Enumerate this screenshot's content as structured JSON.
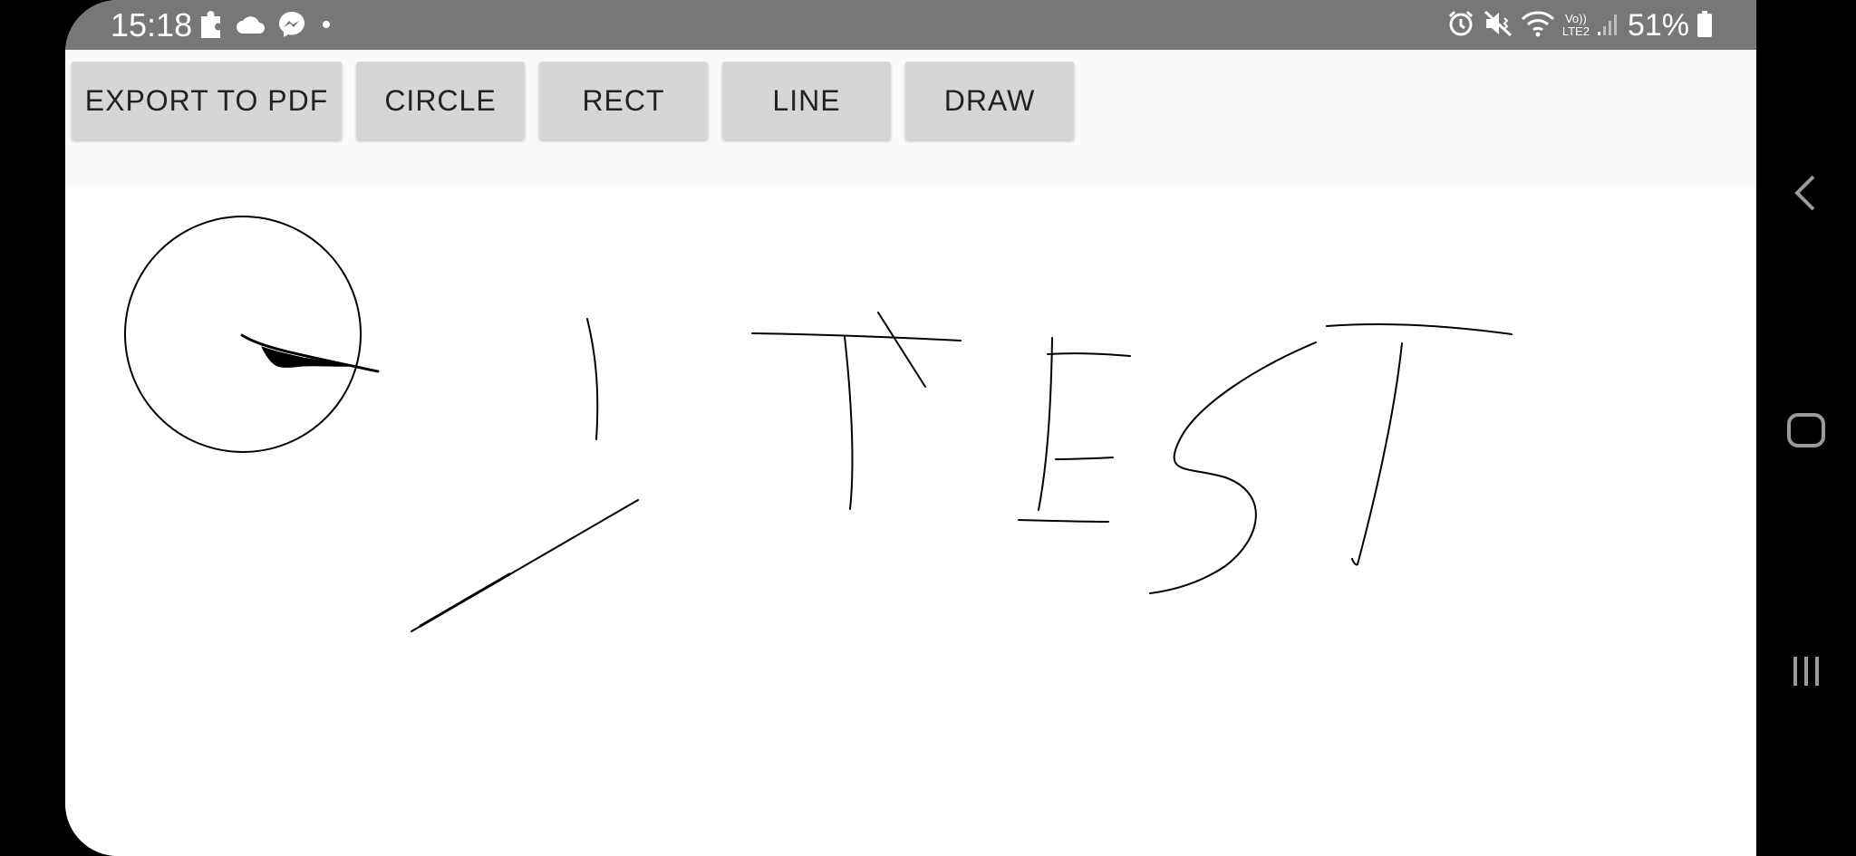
{
  "status_bar": {
    "time": "15:18",
    "battery_percent": "51%",
    "left_icons": [
      "puzzle-icon",
      "cloud-icon",
      "messenger-icon",
      "dot-icon"
    ],
    "right_icons": [
      "alarm-icon",
      "mute-vibrate-icon",
      "wifi-icon",
      "volte-lte2-icon",
      "signal-icon",
      "battery-icon"
    ],
    "volte_label_top": "Vo))",
    "volte_label_bottom": "LTE2"
  },
  "toolbar": {
    "export_label": "EXPORT TO PDF",
    "circle_label": "CIRCLE",
    "rect_label": "RECT",
    "line_label": "LINE",
    "draw_label": "DRAW"
  },
  "colors": {
    "status_bar_bg": "#777777",
    "toolbar_bg": "#fafafa",
    "button_bg": "#d6d6d6",
    "canvas_bg": "#ffffff",
    "stroke": "#000000",
    "nav_bar_bg": "#000000",
    "nav_icon": "#9a9a9a"
  },
  "nav_bar": {
    "icons": [
      "back-icon",
      "home-icon",
      "recents-icon"
    ]
  }
}
